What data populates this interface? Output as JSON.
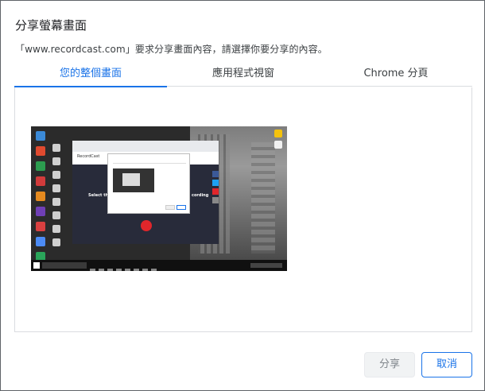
{
  "dialog": {
    "title": "分享螢幕畫面",
    "subtitle": "「www.recordcast.com」要求分享畫面內容，請選擇你要分享的內容。"
  },
  "tabs": [
    {
      "label": "您的整個畫面",
      "active": true
    },
    {
      "label": "應用程式視窗",
      "active": false
    },
    {
      "label": "Chrome 分頁",
      "active": false
    }
  ],
  "screen_preview": {
    "site_logo_text": "RecordCast",
    "hero_left": "Select the",
    "hero_right": "cording"
  },
  "buttons": {
    "share_label": "分享",
    "share_enabled": false,
    "cancel_label": "取消"
  },
  "colors": {
    "accent": "#1a73e8",
    "disabled_bg": "#f1f3f4",
    "disabled_text": "#80868b"
  }
}
